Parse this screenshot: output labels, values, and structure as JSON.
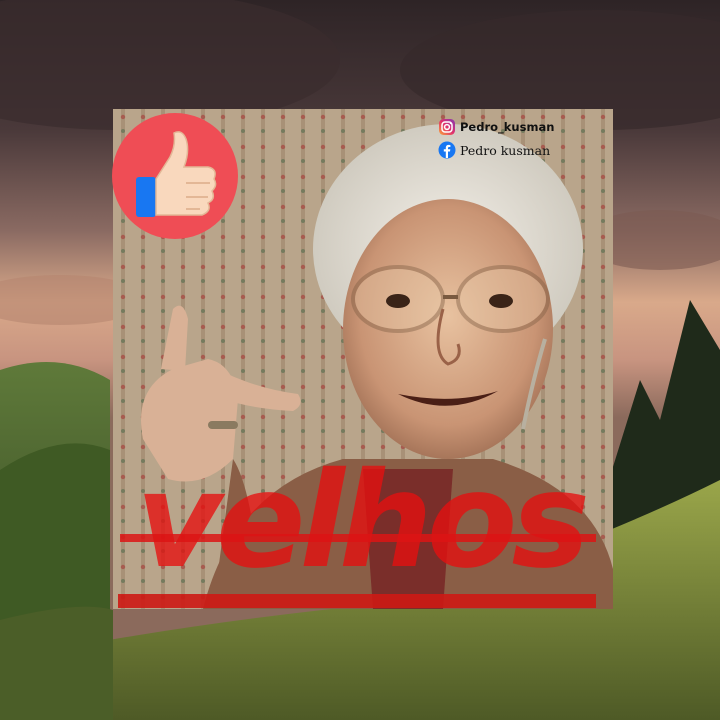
{
  "overlay": {
    "instagram_handle": "Pedro_kusman",
    "facebook_name": "Pedro kusman",
    "word": "velhos"
  },
  "icons": {
    "like": "thumbs-up-icon",
    "instagram": "instagram-icon",
    "facebook": "facebook-icon"
  },
  "colors": {
    "like_circle": "#ef4d55",
    "word_red": "#e60f0f",
    "facebook_blue": "#1877f2"
  }
}
